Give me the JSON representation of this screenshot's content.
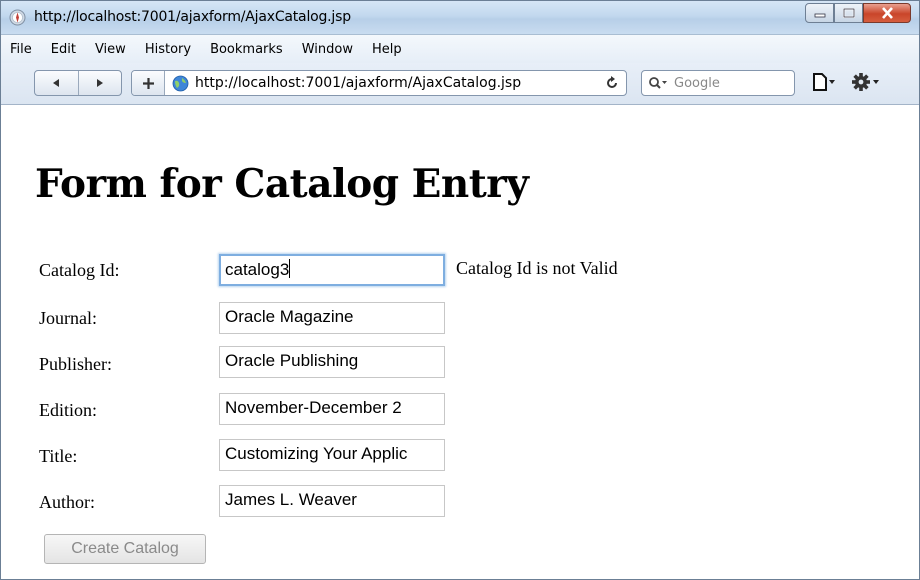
{
  "window": {
    "title": "http://localhost:7001/ajaxform/AjaxCatalog.jsp"
  },
  "menu": [
    "File",
    "Edit",
    "View",
    "History",
    "Bookmarks",
    "Window",
    "Help"
  ],
  "toolbar": {
    "address": "http://localhost:7001/ajaxform/AjaxCatalog.jsp",
    "search_placeholder": "Google"
  },
  "page": {
    "heading": "Form for Catalog Entry",
    "validation_message": "Catalog Id is not Valid",
    "fields": {
      "catalog_id": {
        "label": "Catalog Id:",
        "value": "catalog3"
      },
      "journal": {
        "label": "Journal:",
        "value": "Oracle Magazine"
      },
      "publisher": {
        "label": "Publisher:",
        "value": "Oracle Publishing"
      },
      "edition": {
        "label": "Edition:",
        "value": "November-December 2"
      },
      "title": {
        "label": "Title:",
        "value": "Customizing Your Applic"
      },
      "author": {
        "label": "Author:",
        "value": "James L. Weaver"
      }
    },
    "submit_label": "Create Catalog"
  }
}
